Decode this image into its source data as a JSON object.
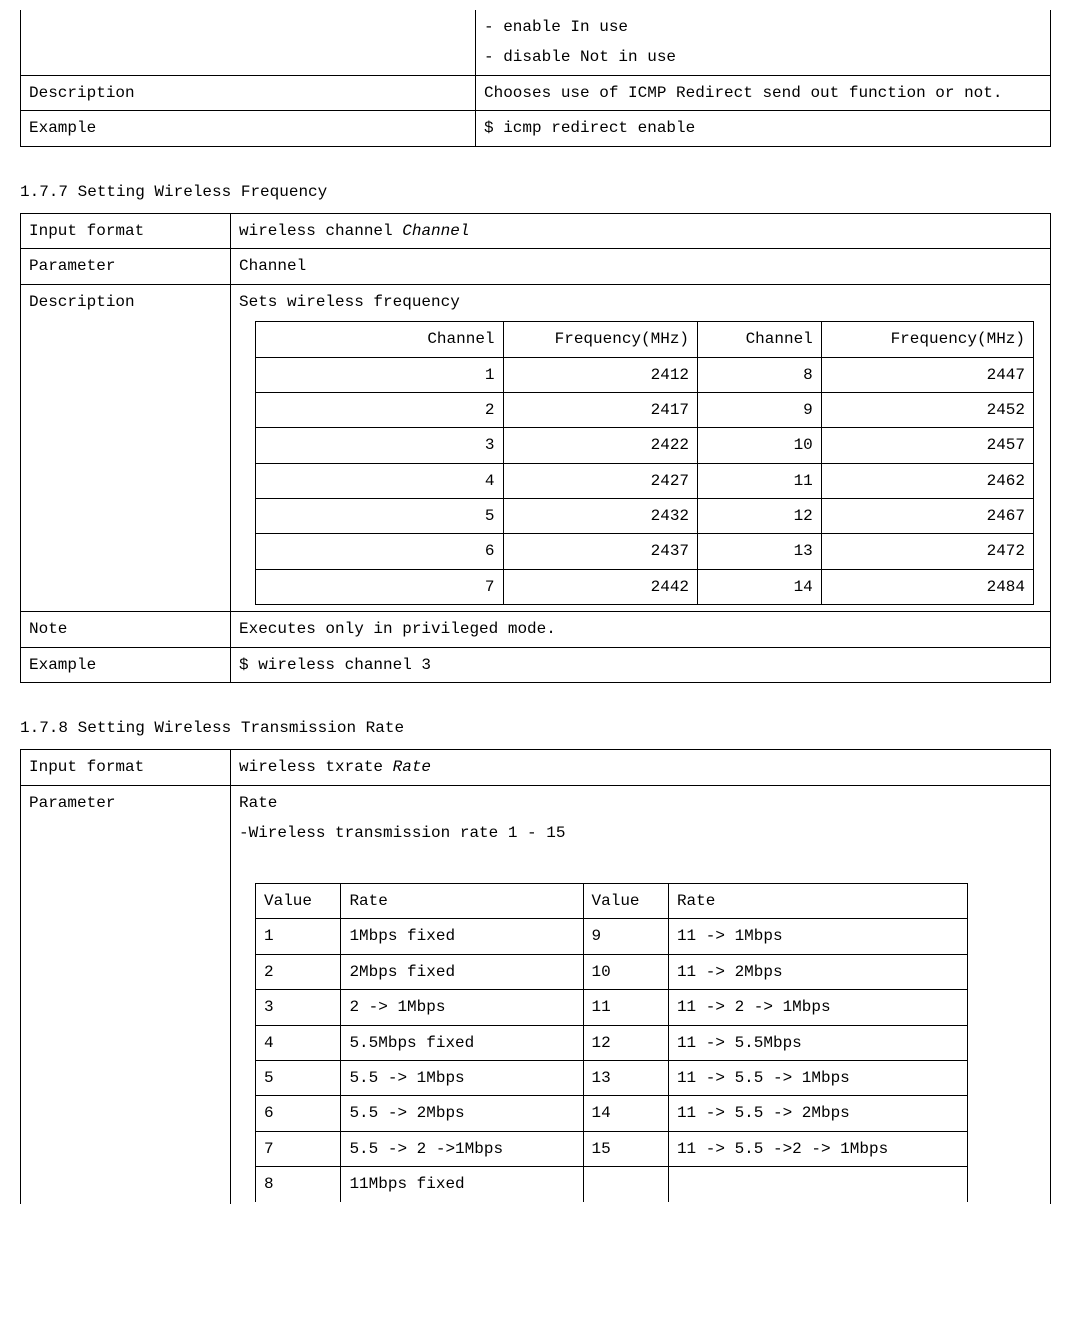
{
  "top_table": {
    "row0_right": "- enable  In use\n- disable  Not in use",
    "desc_label": "Description",
    "desc_value": "Chooses use of ICMP Redirect send out function or not.",
    "example_label": "Example",
    "example_value": "$ icmp redirect enable"
  },
  "section_177": {
    "title": "1.7.7 Setting Wireless Frequency",
    "rows": {
      "input_format_label": "Input format",
      "input_format_value_prefix": "wireless channel ",
      "input_format_value_italic": "Channel",
      "parameter_label": "Parameter",
      "parameter_value": "Channel",
      "description_label": "Description",
      "description_value": "Sets wireless frequency",
      "note_label": "Note",
      "note_value": "Executes only in privileged mode.",
      "example_label": "Example",
      "example_value": "$ wireless channel 3"
    },
    "freq_table": {
      "headers": {
        "c1": "Channel",
        "f1": "Frequency(MHz)",
        "c2": "Channel",
        "f2": "Frequency(MHz)"
      },
      "rows": [
        {
          "c1": "1",
          "f1": "2412",
          "c2": "8",
          "f2": "2447"
        },
        {
          "c1": "2",
          "f1": "2417",
          "c2": "9",
          "f2": "2452"
        },
        {
          "c1": "3",
          "f1": "2422",
          "c2": "10",
          "f2": "2457"
        },
        {
          "c1": "4",
          "f1": "2427",
          "c2": "11",
          "f2": "2462"
        },
        {
          "c1": "5",
          "f1": "2432",
          "c2": "12",
          "f2": "2467"
        },
        {
          "c1": "6",
          "f1": "2437",
          "c2": "13",
          "f2": "2472"
        },
        {
          "c1": "7",
          "f1": "2442",
          "c2": "14",
          "f2": "2484"
        }
      ]
    }
  },
  "section_178": {
    "title": "1.7.8 Setting Wireless Transmission Rate",
    "rows": {
      "input_format_label": "Input format",
      "input_format_value_prefix": "wireless txrate ",
      "input_format_value_italic": "Rate",
      "parameter_label": "Parameter",
      "parameter_line1": "Rate",
      "parameter_line2": "-Wireless transmission rate 1 - 15"
    },
    "rate_table": {
      "headers": {
        "v1": "Value",
        "r1": "Rate",
        "v2": "Value",
        "r2": "Rate"
      },
      "rows": [
        {
          "v1": "1",
          "r1": "1Mbps fixed",
          "v2": "9",
          "r2": "11 -> 1Mbps"
        },
        {
          "v1": "2",
          "r1": "2Mbps fixed",
          "v2": "10",
          "r2": "11 -> 2Mbps"
        },
        {
          "v1": "3",
          "r1": "2 -> 1Mbps",
          "v2": "11",
          "r2": "11 -> 2 -> 1Mbps"
        },
        {
          "v1": "4",
          "r1": "5.5Mbps fixed",
          "v2": "12",
          "r2": "11 -> 5.5Mbps"
        },
        {
          "v1": "5",
          "r1": "5.5 -> 1Mbps",
          "v2": "13",
          "r2": "11 -> 5.5 -> 1Mbps"
        },
        {
          "v1": "6",
          "r1": "5.5 -> 2Mbps",
          "v2": "14",
          "r2": "11 -> 5.5 -> 2Mbps"
        },
        {
          "v1": "7",
          "r1": "5.5 -> 2 ->1Mbps",
          "v2": "15",
          "r2": "11 -> 5.5 ->2 -> 1Mbps"
        },
        {
          "v1": "8",
          "r1": "11Mbps fixed",
          "v2": "",
          "r2": ""
        }
      ]
    }
  }
}
